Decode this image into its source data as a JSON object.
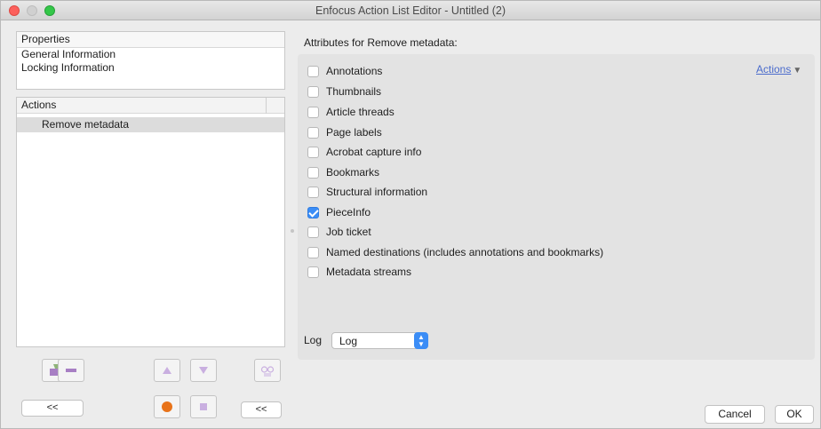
{
  "window": {
    "title": "Enfocus Action List Editor - Untitled (2)"
  },
  "properties": {
    "header": "Properties",
    "items": [
      "General Information",
      "Locking Information"
    ]
  },
  "actions_panel": {
    "header": "Actions",
    "items": [
      "Remove metadata"
    ]
  },
  "attributes": {
    "label": "Attributes for Remove metadata:",
    "actions_link": "Actions",
    "options": [
      {
        "label": "Annotations",
        "checked": false
      },
      {
        "label": "Thumbnails",
        "checked": false
      },
      {
        "label": "Article threads",
        "checked": false
      },
      {
        "label": "Page labels",
        "checked": false
      },
      {
        "label": "Acrobat capture info",
        "checked": false
      },
      {
        "label": "Bookmarks",
        "checked": false
      },
      {
        "label": "Structural information",
        "checked": false
      },
      {
        "label": "PieceInfo",
        "checked": true
      },
      {
        "label": "Job ticket",
        "checked": false
      },
      {
        "label": "Named destinations (includes annotations and bookmarks)",
        "checked": false
      },
      {
        "label": "Metadata streams",
        "checked": false
      }
    ],
    "log_label": "Log",
    "log_value": "Log"
  },
  "toolbar": {
    "collapse_left_label": "<<",
    "collapse_right_label": "<<"
  },
  "buttons": {
    "cancel": "Cancel",
    "ok": "OK"
  },
  "colors": {
    "accent": "#3b8df6",
    "link": "#4b6ccc",
    "icon_purple": "#a87fc4",
    "record_orange": "#e8731a"
  }
}
